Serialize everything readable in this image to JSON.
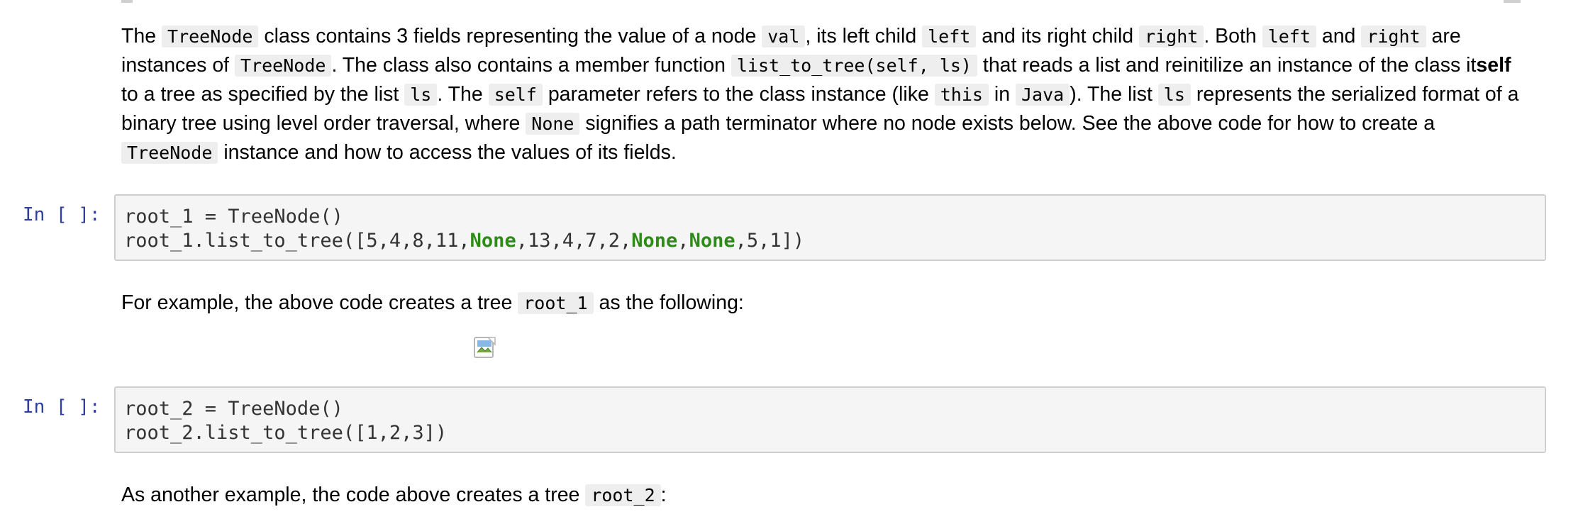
{
  "intro": {
    "t1": "The ",
    "c_treenode": "TreeNode",
    "t2": " class contains 3 fields representing the value of a node ",
    "c_val": "val",
    "t3": ", its left child ",
    "c_left": "left",
    "t4": " and its right child ",
    "c_right": "right",
    "t5": ". Both ",
    "t6": " and ",
    "t7": " are instances of ",
    "t8": ". The class also contains a member function ",
    "c_func": "list_to_tree(self, ls)",
    "t9": " that reads a list and reinitilize an instance of the class it",
    "b_self": "self",
    "t10": " to a tree as specified by the list ",
    "c_ls": "ls",
    "t11": ". The ",
    "c_self": "self",
    "t12": " parameter refers to the class instance (like ",
    "c_this": "this",
    "t13": " in ",
    "c_java": "Java",
    "t14": "). The list ",
    "t15": " represents the serialized format of a binary tree using level order traversal, where ",
    "c_none": "None",
    "t16": " signifies a path terminator where no node exists below. See the above code for how to create a ",
    "t17": " instance and how to access the values of its fields."
  },
  "cell1": {
    "prompt": "In [ ]:",
    "line1": "root_1 = TreeNode()",
    "line2_a": "root_1.list_to_tree([5,4,8,11,",
    "kw": "None",
    "line2_b": ",13,4,7,2,",
    "line2_c": ",",
    "line2_d": ",5,1])"
  },
  "example1": {
    "t1": "For example, the above code creates a tree ",
    "code": "root_1",
    "t2": " as the following:"
  },
  "cell2": {
    "prompt": "In [ ]:",
    "line1": "root_2 = TreeNode()",
    "line2": "root_2.list_to_tree([1,2,3])"
  },
  "example2": {
    "t1": "As another example, the code above creates a tree ",
    "code": "root_2",
    "t2": ":"
  }
}
